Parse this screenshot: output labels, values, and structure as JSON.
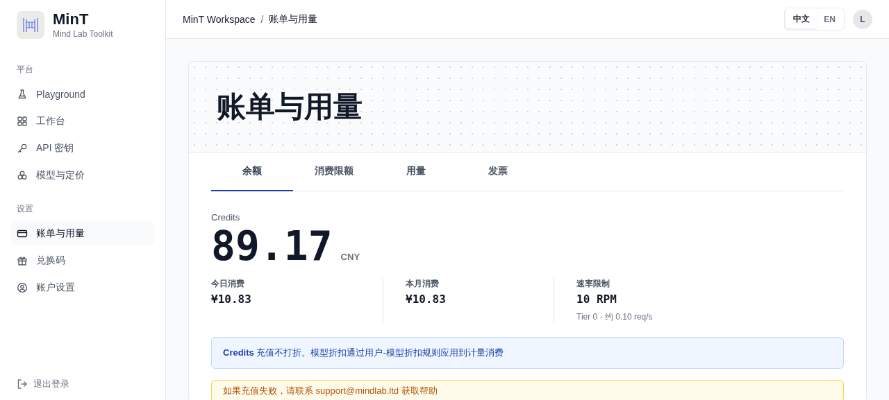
{
  "brand": {
    "name": "MinT",
    "subtitle": "Mind Lab Toolkit"
  },
  "sidebar": {
    "sections": [
      {
        "title": "平台",
        "items": [
          {
            "label": "Playground",
            "selected": false
          },
          {
            "label": "工作台",
            "selected": false
          },
          {
            "label": "API 密钥",
            "selected": false
          },
          {
            "label": "模型与定价",
            "selected": false
          }
        ]
      },
      {
        "title": "设置",
        "items": [
          {
            "label": "账单与用量",
            "selected": true
          },
          {
            "label": "兑换码",
            "selected": false
          },
          {
            "label": "账户设置",
            "selected": false
          }
        ]
      }
    ],
    "logout": "退出登录"
  },
  "header": {
    "breadcrumb": [
      "MinT Workspace",
      "账单与用量"
    ],
    "separator": "/",
    "languages": [
      {
        "label": "中文",
        "selected": true
      },
      {
        "label": "EN",
        "selected": false
      }
    ],
    "avatar": "L"
  },
  "page": {
    "title": "账单与用量",
    "tabs": [
      {
        "label": "余额",
        "selected": true
      },
      {
        "label": "消费限额",
        "selected": false
      },
      {
        "label": "用量",
        "selected": false
      },
      {
        "label": "发票",
        "selected": false
      }
    ],
    "balance": {
      "label": "Credits",
      "amount": "89.17",
      "currency": "CNY"
    },
    "stats": [
      {
        "label": "今日消费",
        "value": "¥10.83"
      },
      {
        "label": "本月消费",
        "value": "¥10.83"
      },
      {
        "label": "速率限制",
        "value": "10 RPM",
        "note": "Tier 0 · 约 0.10 req/s"
      }
    ],
    "notices": [
      {
        "kind": "info",
        "text": "**Credits** 充值不打折。模型折扣通过用户-模型折扣规则应用到计量消费"
      },
      {
        "kind": "warning",
        "text": "如果充值失败，请联系 support@mindlab.ltd 获取帮助"
      }
    ]
  }
}
